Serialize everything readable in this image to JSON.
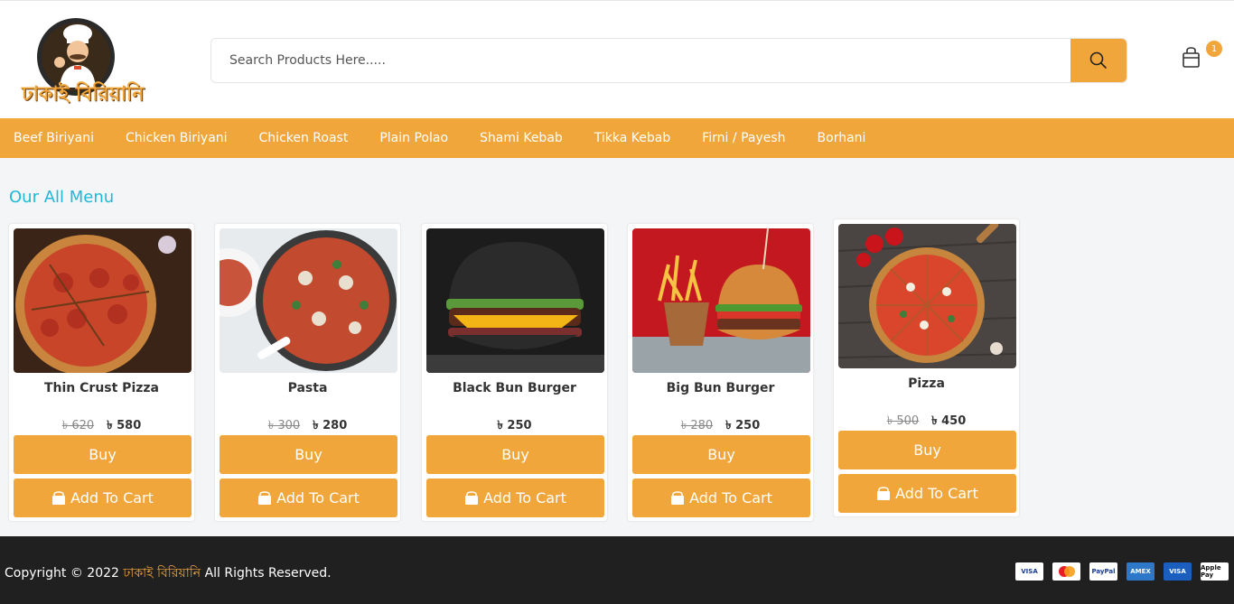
{
  "header": {
    "logo_text": "ঢাকাই বিরিয়ানি",
    "search_placeholder": "Search Products Here.....",
    "cart_count": "1"
  },
  "nav": [
    "Beef Biriyani",
    "Chicken Biriyani",
    "Chicken Roast",
    "Plain Polao",
    "Shami Kebab",
    "Tikka Kebab",
    "Firni / Payesh",
    "Borhani"
  ],
  "section_title": "Our All Menu",
  "products": [
    {
      "name": "Thin Crust Pizza",
      "old_price": "৳ 620",
      "price": "৳ 580",
      "buy_label": "Buy",
      "cart_label": "Add To Cart"
    },
    {
      "name": "Pasta",
      "old_price": "৳ 300",
      "price": "৳ 280",
      "buy_label": "Buy",
      "cart_label": "Add To Cart"
    },
    {
      "name": "Black Bun Burger",
      "old_price": "",
      "price": "৳ 250",
      "buy_label": "Buy",
      "cart_label": "Add To Cart"
    },
    {
      "name": "Big Bun Burger",
      "old_price": "৳ 280",
      "price": "৳ 250",
      "buy_label": "Buy",
      "cart_label": "Add To Cart"
    },
    {
      "name": "Pizza",
      "old_price": "৳ 500",
      "price": "৳ 450",
      "buy_label": "Buy",
      "cart_label": "Add To Cart"
    }
  ],
  "footer": {
    "copyright_prefix": "Copyright © 2022",
    "brand": "ঢাকাই বিরিয়ানি",
    "copyright_suffix": "All Rights Reserved.",
    "payments": [
      "VISA",
      "Mastercard",
      "PayPal",
      "AMEX",
      "VISA",
      "Apple Pay"
    ]
  },
  "colors": {
    "accent": "#f0a63a",
    "title": "#20b8d8",
    "footer_bg": "#202020"
  }
}
